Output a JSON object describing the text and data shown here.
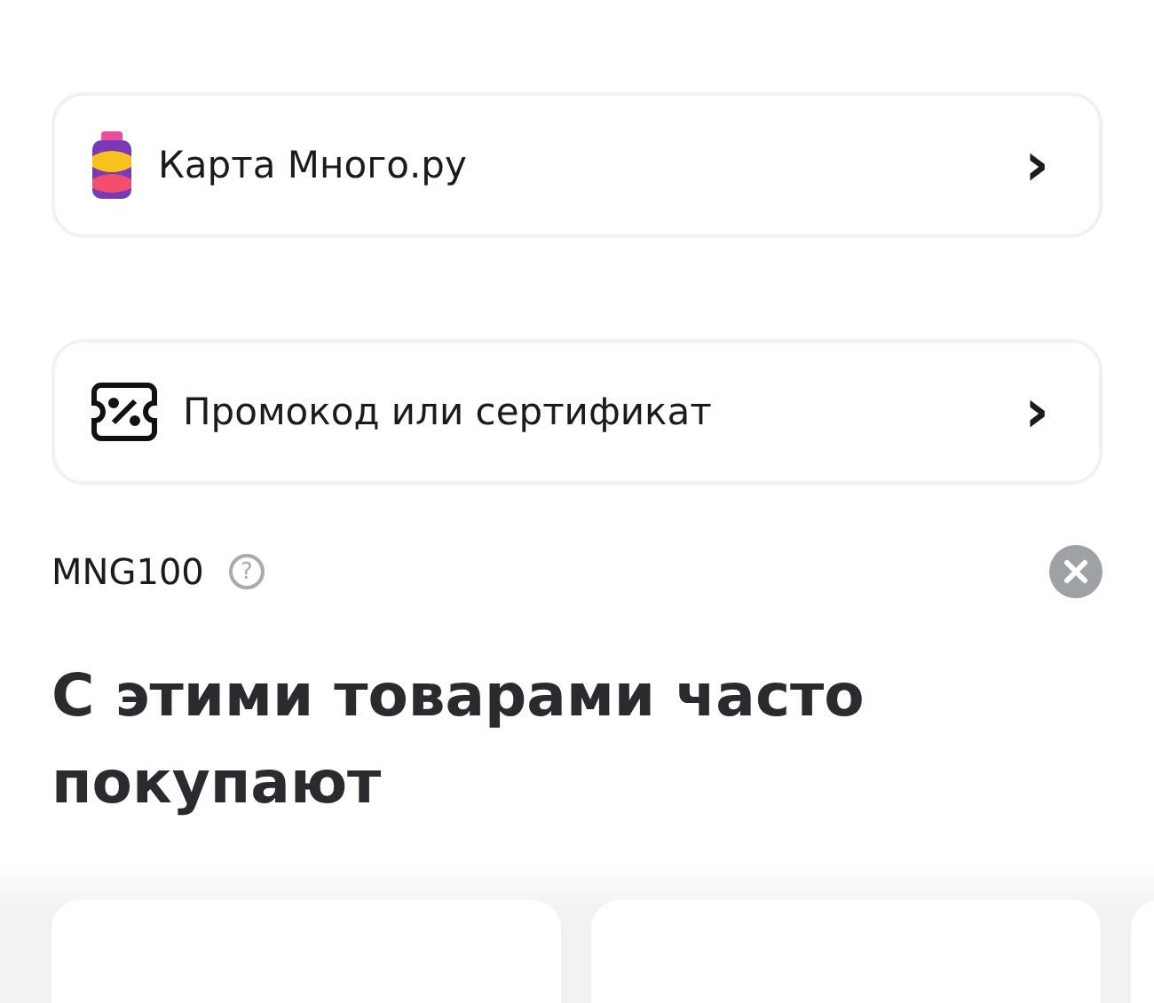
{
  "links": [
    {
      "kind": "loyalty",
      "label": "Карта Много.ру",
      "chevron": "›"
    },
    {
      "kind": "promo",
      "label": "Промокод или сертификат",
      "chevron": "›"
    }
  ],
  "applied_code": {
    "code": "MNG100",
    "help": "?"
  },
  "recommendations": {
    "title": "С этими товарами часто покупают"
  }
}
